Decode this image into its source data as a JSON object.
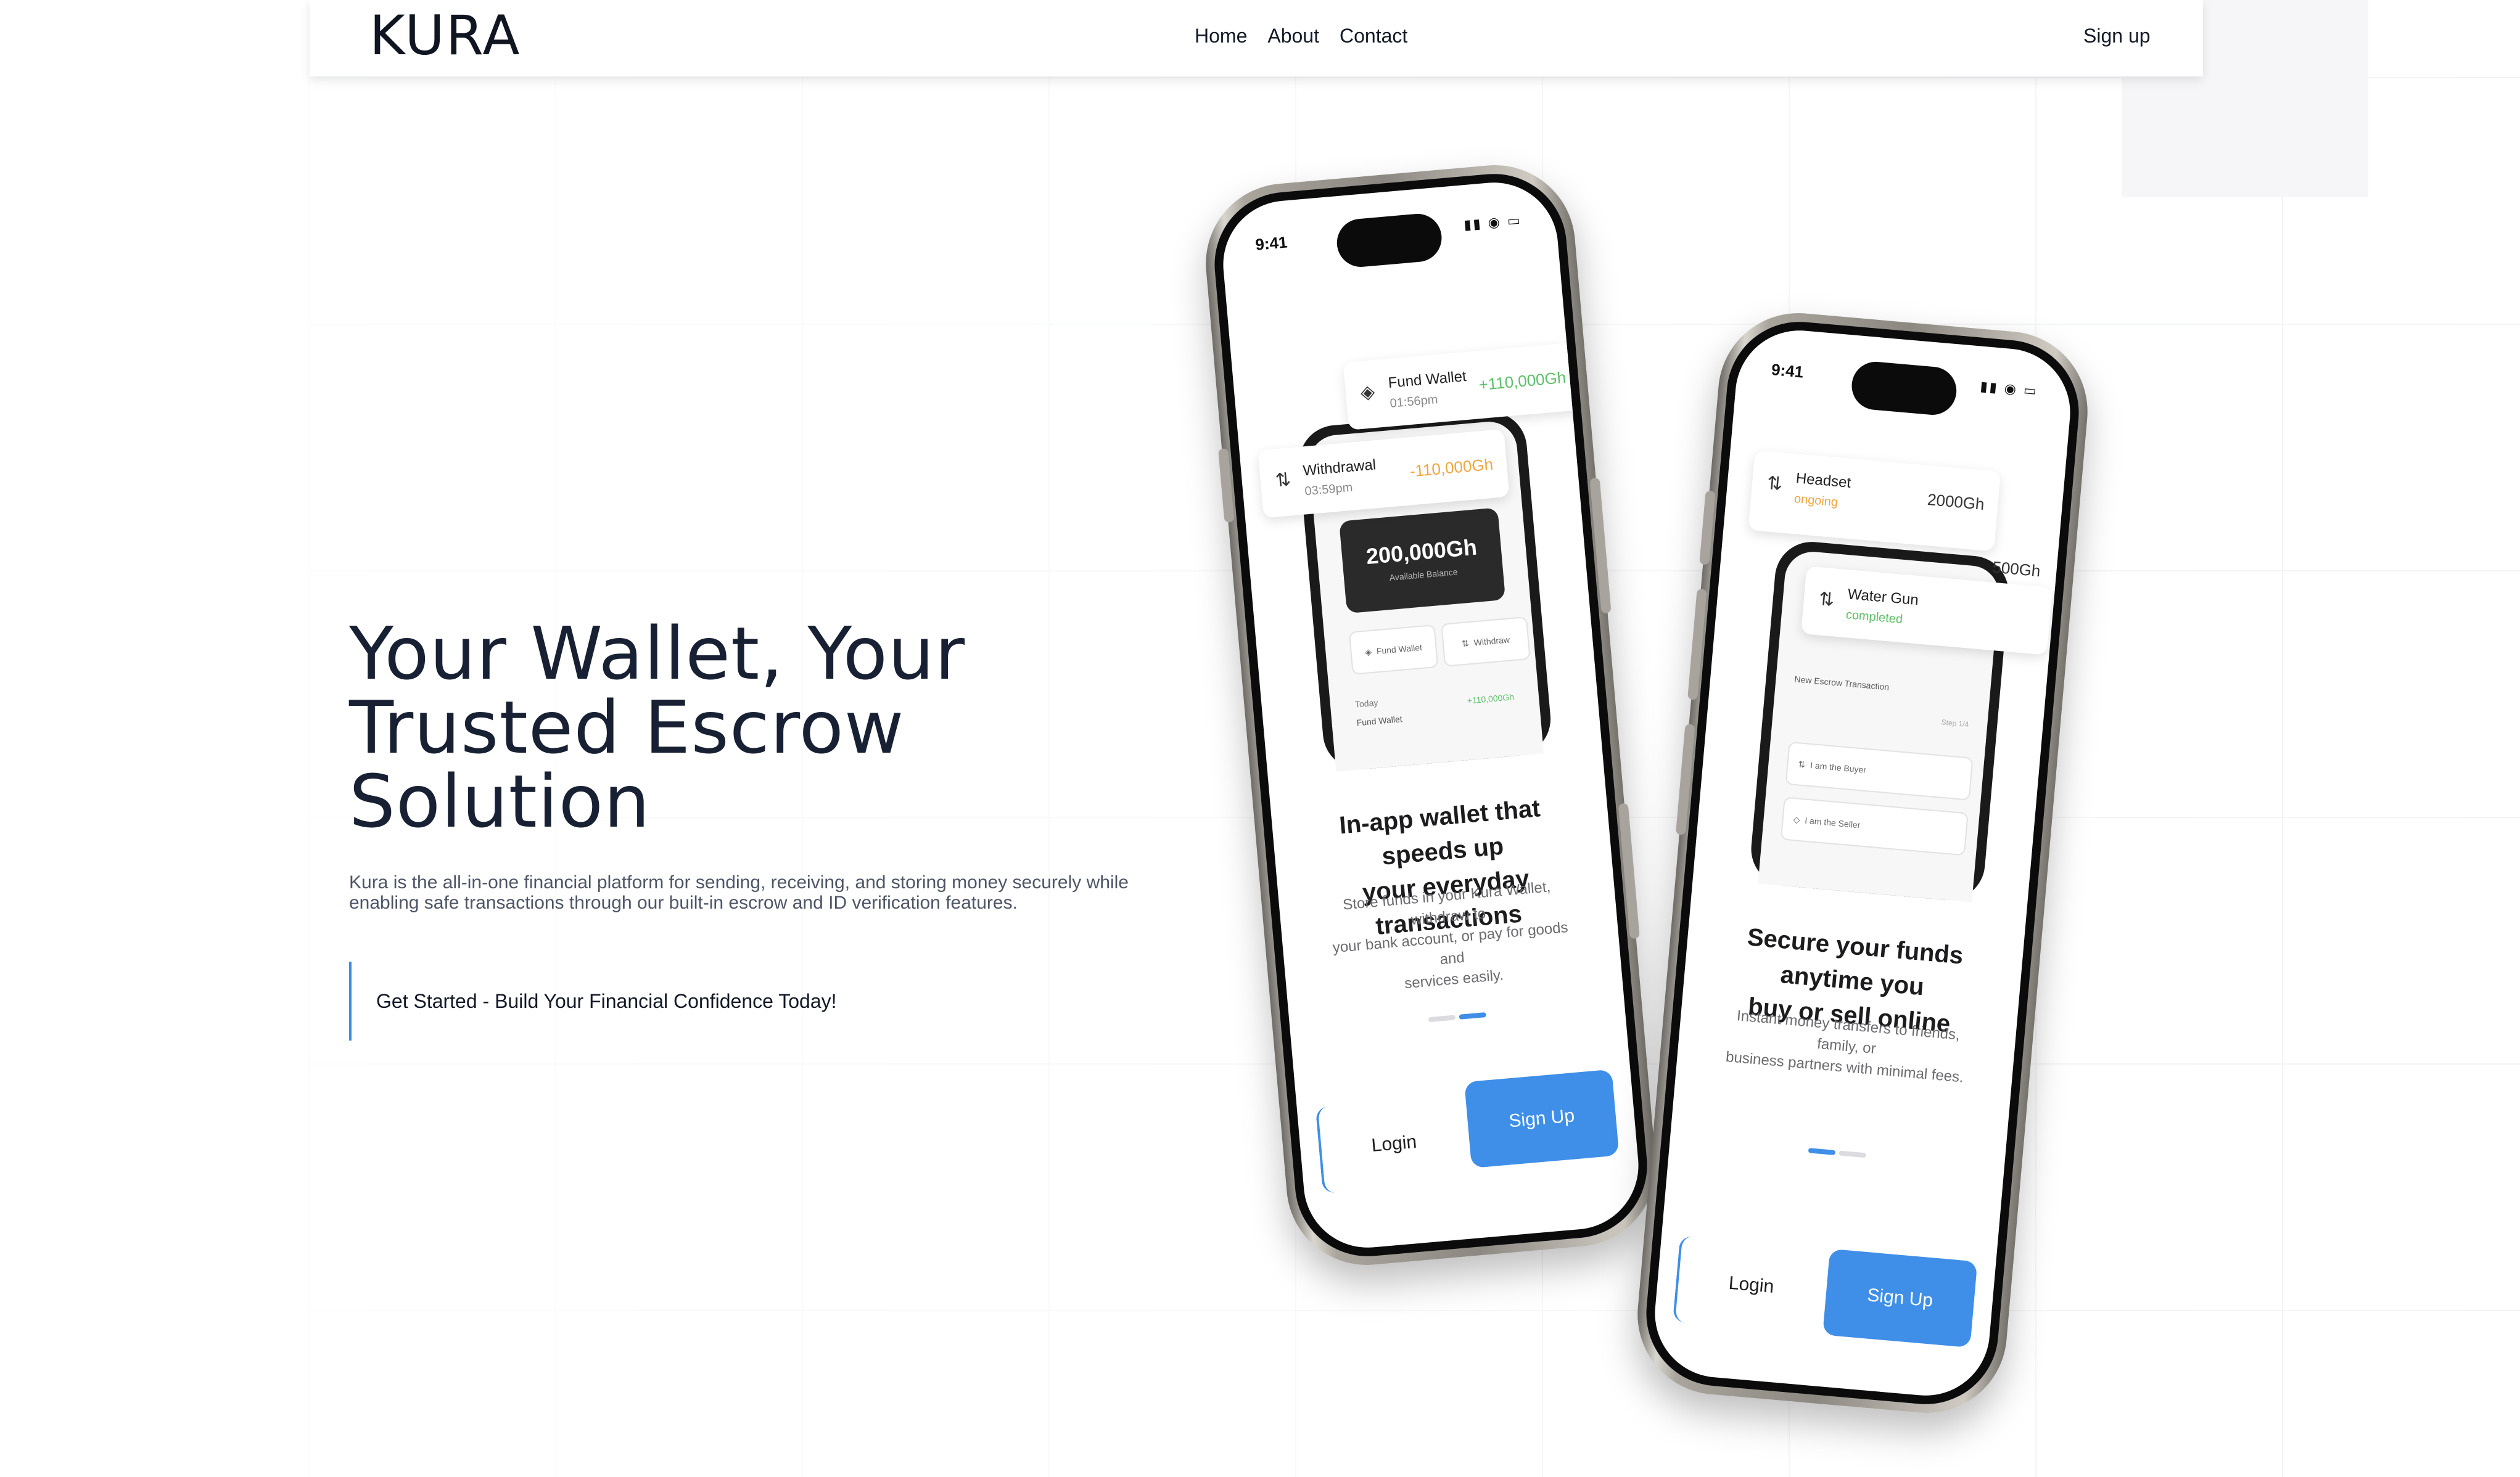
{
  "nav": {
    "logo": "KURA",
    "links": [
      "Home",
      "About",
      "Contact"
    ],
    "signup": "Sign up"
  },
  "hero": {
    "headline_lines": [
      "Your Wallet, Your",
      "Trusted Escrow",
      "Solution"
    ],
    "subtext_lines": [
      "Kura is the all-in-one financial platform for sending, receiving, and storing money securely while",
      "enabling safe transactions through our built-in escrow and ID verification features."
    ],
    "cta": "Get Started - Build Your Financial Confidence Today!"
  },
  "phone1": {
    "time": "9:41",
    "fund_wallet": {
      "title": "Fund Wallet",
      "time": "01:56pm",
      "amount": "+110,000Gh"
    },
    "withdrawal": {
      "title": "Withdrawal",
      "time": "03:59pm",
      "amount": "-110,000Gh"
    },
    "balance": {
      "value": "200,000Gh",
      "label": "Available Balance"
    },
    "buttons": [
      "Fund Wallet",
      "Withdraw"
    ],
    "today_label": "Today",
    "today_item": {
      "title": "Fund Wallet",
      "amount": "+110,000Gh"
    },
    "title_lines": [
      "In-app wallet that speeds up",
      "your everyday transactions"
    ],
    "desc_lines": [
      "Store funds in your Kura Wallet, withdraw to",
      "your bank account, or pay for goods and",
      "services easily."
    ],
    "login": "Login",
    "signup": "Sign Up"
  },
  "phone2": {
    "time": "9:41",
    "headset": {
      "title": "Headset",
      "status": "ongoing",
      "amount": "2000Gh"
    },
    "water_gun": {
      "title": "Water Gun",
      "status": "completed",
      "amount": "500Gh"
    },
    "new_escrow": "New Escrow Transaction",
    "step": "Step 1/4",
    "options": [
      "I am the Buyer",
      "I am the Seller"
    ],
    "title_lines": [
      "Secure your funds anytime you",
      "buy or sell online"
    ],
    "desc_lines": [
      "Instant money transfers to friends, family, or",
      "business partners with minimal fees."
    ],
    "login": "Login",
    "signup": "Sign Up"
  },
  "colors": {
    "accent": "#3f8ee8",
    "positive": "#5cbf6a",
    "negative": "#f0a640",
    "text": "#182033"
  }
}
